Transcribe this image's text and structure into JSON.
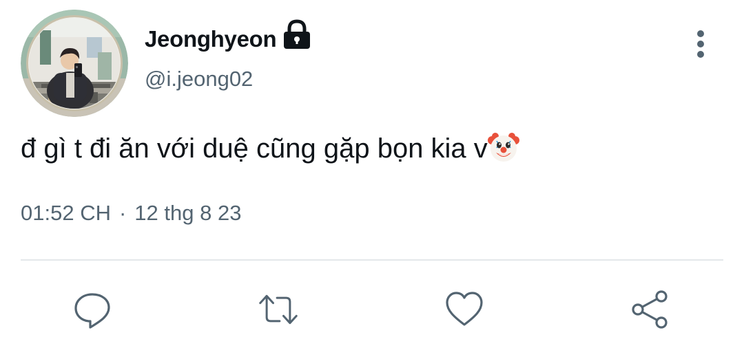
{
  "user": {
    "display_name": "Jeonghyeon",
    "handle": "@i.jeong02",
    "avatar_icon": "profile-photo",
    "protected_icon": "lock-icon"
  },
  "tweet": {
    "text": "đ gì t đi ăn với duệ cũng gặp bọn kia v",
    "emoji": "clown-face-emoji",
    "time": "01:52 CH",
    "separator": "·",
    "date": "12 thg 8 23"
  },
  "actions": {
    "reply_icon": "reply-icon",
    "retweet_icon": "retweet-icon",
    "like_icon": "heart-icon",
    "share_icon": "share-icon"
  },
  "colors": {
    "text_primary": "#0f1419",
    "text_secondary": "#536471",
    "divider": "#e4e7ea",
    "icon": "#536471"
  }
}
